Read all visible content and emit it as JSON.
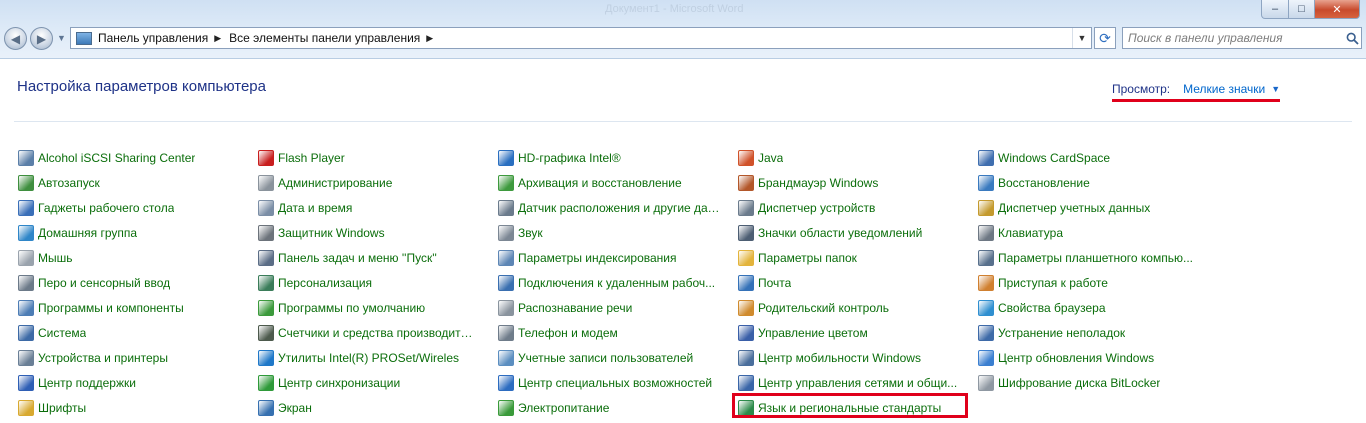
{
  "window": {
    "title_faded": "Документ1 - Microsoft Word",
    "minimize": "–",
    "maximize": "□",
    "close": "✕"
  },
  "address": {
    "crumbs": [
      "Панель управления",
      "Все элементы панели управления"
    ],
    "search_placeholder": "Поиск в панели управления"
  },
  "header": {
    "title": "Настройка параметров компьютера",
    "view_label": "Просмотр:",
    "view_value": "Мелкие значки"
  },
  "columns": [
    [
      {
        "label": "Alcohol iSCSI Sharing Center",
        "icon": "alcohol-iscsi-icon",
        "color": "#5b7fa8"
      },
      {
        "label": "Автозапуск",
        "icon": "autoplay-icon",
        "color": "#3f8f3f"
      },
      {
        "label": "Гаджеты рабочего стола",
        "icon": "gadgets-icon",
        "color": "#3a6fb8"
      },
      {
        "label": "Домашняя группа",
        "icon": "homegroup-icon",
        "color": "#2f86c8"
      },
      {
        "label": "Мышь",
        "icon": "mouse-icon",
        "color": "#9aa3ad"
      },
      {
        "label": "Перо и сенсорный ввод",
        "icon": "pen-touch-icon",
        "color": "#6c7a89"
      },
      {
        "label": "Программы и компоненты",
        "icon": "programs-icon",
        "color": "#4d7db5"
      },
      {
        "label": "Система",
        "icon": "system-icon",
        "color": "#3d6aa6"
      },
      {
        "label": "Устройства и принтеры",
        "icon": "devices-printers-icon",
        "color": "#6a7f96"
      },
      {
        "label": "Центр поддержки",
        "icon": "action-center-flag-icon",
        "color": "#2f5fb5"
      },
      {
        "label": "Шрифты",
        "icon": "fonts-icon",
        "color": "#d8a930"
      }
    ],
    [
      {
        "label": "Flash Player",
        "icon": "flash-player-icon",
        "color": "#c81e1e"
      },
      {
        "label": "Администрирование",
        "icon": "admin-tools-icon",
        "color": "#8a939c"
      },
      {
        "label": "Дата и время",
        "icon": "date-time-icon",
        "color": "#7b8ea6"
      },
      {
        "label": "Защитник Windows",
        "icon": "windows-defender-icon",
        "color": "#6c737b"
      },
      {
        "label": "Панель задач и меню ''Пуск''",
        "icon": "taskbar-start-icon",
        "color": "#5b6d86"
      },
      {
        "label": "Персонализация",
        "icon": "personalization-icon",
        "color": "#3b7d5a"
      },
      {
        "label": "Программы по умолчанию",
        "icon": "default-programs-icon",
        "color": "#3c9a3c"
      },
      {
        "label": "Счетчики и средства производител...",
        "icon": "performance-icon",
        "color": "#4d5a4d"
      },
      {
        "label": "Утилиты Intel(R) PROSet/Wireles",
        "icon": "intel-wireless-icon",
        "color": "#1f78c8"
      },
      {
        "label": "Центр синхронизации",
        "icon": "sync-center-icon",
        "color": "#2f9a3a"
      },
      {
        "label": "Экран",
        "icon": "display-icon",
        "color": "#3670b0"
      }
    ],
    [
      {
        "label": "HD-графика Intel®",
        "icon": "intel-graphics-icon",
        "color": "#2a6fc0"
      },
      {
        "label": "Архивация и восстановление",
        "icon": "backup-restore-icon",
        "color": "#3e9a3e"
      },
      {
        "label": "Датчик расположения и другие дат...",
        "icon": "location-sensor-icon",
        "color": "#6b7b8c"
      },
      {
        "label": "Звук",
        "icon": "sound-icon",
        "color": "#7c8794"
      },
      {
        "label": "Параметры индексирования",
        "icon": "indexing-icon",
        "color": "#5d86b5"
      },
      {
        "label": "Подключения к удаленным рабоч...",
        "icon": "remote-app-icon",
        "color": "#3a6fb0"
      },
      {
        "label": "Распознавание речи",
        "icon": "speech-recognition-icon",
        "color": "#8a949e"
      },
      {
        "label": "Телефон и модем",
        "icon": "phone-modem-icon",
        "color": "#6f7c8a"
      },
      {
        "label": "Учетные записи пользователей",
        "icon": "user-accounts-icon",
        "color": "#5b8ec0"
      },
      {
        "label": "Центр специальных возможностей",
        "icon": "ease-of-access-icon",
        "color": "#2d6cc0"
      },
      {
        "label": "Электропитание",
        "icon": "power-options-icon",
        "color": "#3a9a3a"
      }
    ],
    [
      {
        "label": "Java",
        "icon": "java-icon",
        "color": "#d0522a"
      },
      {
        "label": "Брандмауэр Windows",
        "icon": "firewall-icon",
        "color": "#b3572a"
      },
      {
        "label": "Диспетчер устройств",
        "icon": "device-manager-icon",
        "color": "#6b7b8c"
      },
      {
        "label": "Значки области уведомлений",
        "icon": "notification-icons-icon",
        "color": "#4d5e73"
      },
      {
        "label": "Параметры папок",
        "icon": "folder-options-icon",
        "color": "#e3b43c"
      },
      {
        "label": "Почта",
        "icon": "mail-icon",
        "color": "#3572b8"
      },
      {
        "label": "Родительский контроль",
        "icon": "parental-controls-icon",
        "color": "#d08b2e"
      },
      {
        "label": "Управление цветом",
        "icon": "color-management-icon",
        "color": "#3a5fa8"
      },
      {
        "label": "Центр мобильности Windows",
        "icon": "mobility-center-icon",
        "color": "#4a6e9c"
      },
      {
        "label": "Центр управления сетями и общи...",
        "icon": "network-center-icon",
        "color": "#3a66a8"
      },
      {
        "label": "Язык и региональные стандарты",
        "icon": "region-language-icon",
        "color": "#2c8a4a"
      }
    ],
    [
      {
        "label": "Windows CardSpace",
        "icon": "cardspace-icon",
        "color": "#3f6eaf"
      },
      {
        "label": "Восстановление",
        "icon": "recovery-icon",
        "color": "#3a7abf"
      },
      {
        "label": "Диспетчер учетных данных",
        "icon": "credential-manager-icon",
        "color": "#c49a2e"
      },
      {
        "label": "Клавиатура",
        "icon": "keyboard-icon",
        "color": "#6e7884"
      },
      {
        "label": "Параметры планшетного компью...",
        "icon": "tablet-settings-icon",
        "color": "#58708c"
      },
      {
        "label": "Приступая к работе",
        "icon": "getting-started-icon",
        "color": "#d08030"
      },
      {
        "label": "Свойства браузера",
        "icon": "internet-options-icon",
        "color": "#2f8fd0"
      },
      {
        "label": "Устранение неполадок",
        "icon": "troubleshooting-icon",
        "color": "#3e6aa8"
      },
      {
        "label": "Центр обновления Windows",
        "icon": "windows-update-icon",
        "color": "#3b7fd0"
      },
      {
        "label": "Шифрование диска BitLocker",
        "icon": "bitlocker-icon",
        "color": "#8f98a2"
      }
    ]
  ]
}
